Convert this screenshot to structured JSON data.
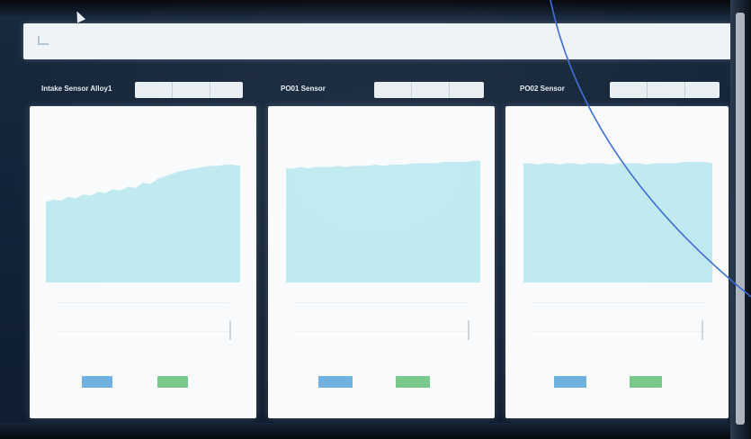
{
  "topbar": {
    "title": "",
    "icon": "chart-icon"
  },
  "panels": [
    {
      "title": "Intake Sensor Alloy1",
      "buttons": [
        "",
        "",
        ""
      ],
      "chart_subtitle": "",
      "x_label": "",
      "section_label": "",
      "row_left": "",
      "row_tick_top": "",
      "row_tick_bottom": "",
      "badge_blue": "",
      "badge_green": "",
      "footnote": "",
      "area_profile": [
        0.62,
        0.64,
        0.63,
        0.66,
        0.65,
        0.68,
        0.67,
        0.7,
        0.69,
        0.72,
        0.71,
        0.74,
        0.73,
        0.77,
        0.76,
        0.8,
        0.82,
        0.84,
        0.86,
        0.87,
        0.88,
        0.89,
        0.9,
        0.9,
        0.91,
        0.91,
        0.9
      ]
    },
    {
      "title": "PO01 Sensor",
      "buttons": [
        "",
        "",
        ""
      ],
      "chart_subtitle": "",
      "x_label": "",
      "section_label": "",
      "row_left": "",
      "row_tick_top": "",
      "row_tick_bottom": "",
      "badge_blue": "",
      "badge_green": "",
      "footnote": "",
      "area_profile": [
        0.88,
        0.88,
        0.89,
        0.88,
        0.89,
        0.89,
        0.89,
        0.9,
        0.89,
        0.9,
        0.9,
        0.9,
        0.91,
        0.9,
        0.91,
        0.91,
        0.91,
        0.92,
        0.92,
        0.92,
        0.92,
        0.93,
        0.93,
        0.93,
        0.93,
        0.94,
        0.94
      ]
    },
    {
      "title": "PO02 Sensor",
      "buttons": [
        "",
        "",
        ""
      ],
      "chart_subtitle": "",
      "x_label": "",
      "section_label": "",
      "row_left": "",
      "row_tick_top": "",
      "row_tick_bottom": "",
      "badge_blue": "",
      "badge_green": "",
      "footnote": "",
      "area_profile": [
        0.92,
        0.92,
        0.91,
        0.92,
        0.92,
        0.91,
        0.92,
        0.92,
        0.91,
        0.92,
        0.92,
        0.92,
        0.91,
        0.92,
        0.92,
        0.92,
        0.92,
        0.91,
        0.92,
        0.92,
        0.92,
        0.92,
        0.93,
        0.93,
        0.93,
        0.93,
        0.92
      ]
    }
  ],
  "colors": {
    "area_fill": "#bfe9f0",
    "badge_blue": "#6fb0e0",
    "badge_green": "#79c88b",
    "background": "#13243a"
  }
}
